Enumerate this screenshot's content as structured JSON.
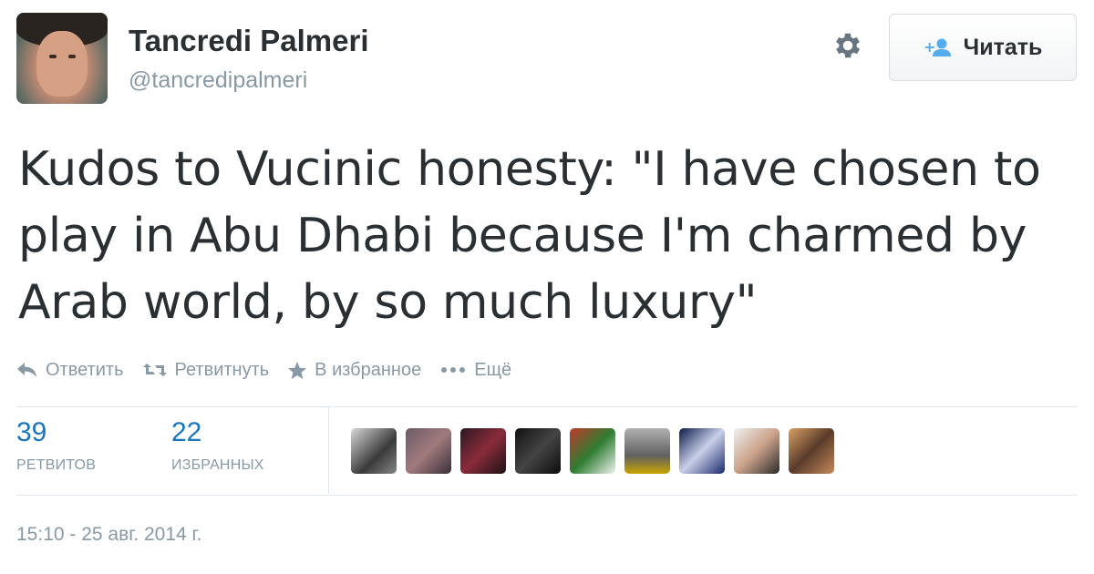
{
  "author": {
    "name": "Tancredi Palmeri",
    "handle": "@tancredipalmeri"
  },
  "follow_button": {
    "label": "Читать"
  },
  "tweet": {
    "text": "Kudos to Vucinic honesty: \"I have chosen to play in Abu Dhabi because I'm charmed by Arab world, by so much luxury\""
  },
  "actions": [
    {
      "label": "Ответить",
      "icon": "reply-icon"
    },
    {
      "label": "Ретвитнуть",
      "icon": "retweet-icon"
    },
    {
      "label": "В избранное",
      "icon": "star-icon"
    },
    {
      "label": "Ещё",
      "icon": "more-icon"
    }
  ],
  "stats": {
    "retweets": {
      "count": "39",
      "label": "РЕТВИТОВ"
    },
    "favorites": {
      "count": "22",
      "label": "ИЗБРАННЫХ"
    }
  },
  "timestamp": "15:10 - 25 авг. 2014 г.",
  "colors": {
    "link_blue": "#1b76c0",
    "muted_gray": "#8899a6",
    "text_dark": "#292f33"
  }
}
